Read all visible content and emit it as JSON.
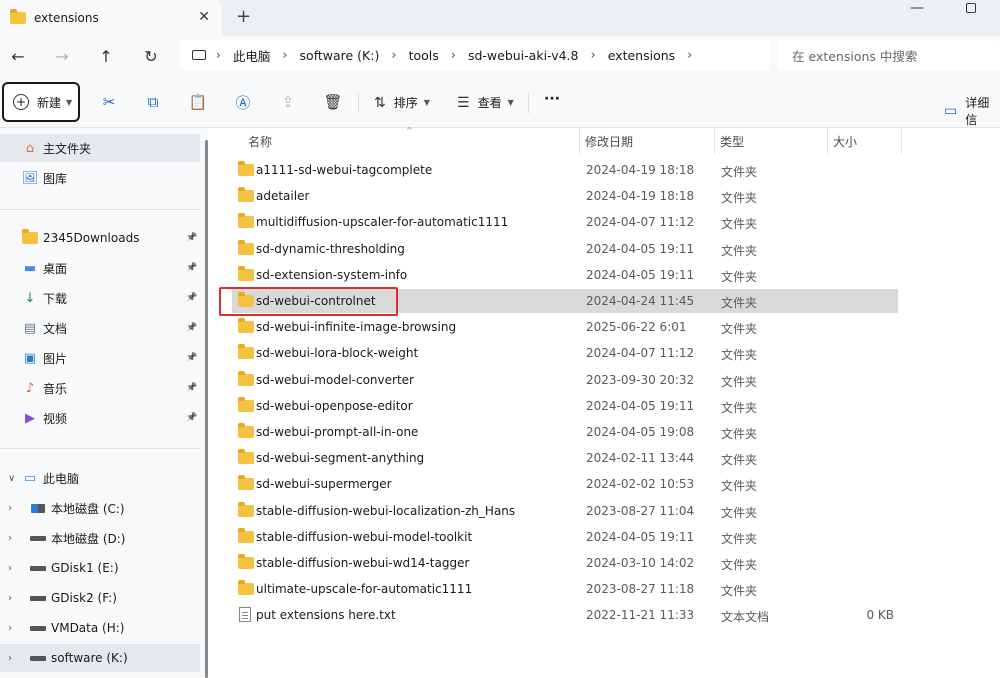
{
  "window": {
    "tab_title": "extensions",
    "close_tab": "✕",
    "new_tab": "+"
  },
  "nav": {
    "breadcrumb": [
      "此电脑",
      "software (K:)",
      "tools",
      "sd-webui-aki-v4.8",
      "extensions"
    ],
    "search_placeholder": "在 extensions 中搜索"
  },
  "toolbar": {
    "new_label": "新建",
    "sort_label": "排序",
    "view_label": "查看",
    "more_label": "···",
    "details_label": "详细信"
  },
  "sidebar": {
    "top": [
      {
        "label": "主文件夹",
        "icon": "home-icon",
        "selected": true
      },
      {
        "label": "图库",
        "icon": "gallery-icon",
        "selected": false
      }
    ],
    "pinned": [
      {
        "label": "2345Downloads",
        "icon": "folder-icon"
      },
      {
        "label": "桌面",
        "icon": "desktop-icon"
      },
      {
        "label": "下载",
        "icon": "download-icon"
      },
      {
        "label": "文档",
        "icon": "document-icon"
      },
      {
        "label": "图片",
        "icon": "pictures-icon"
      },
      {
        "label": "音乐",
        "icon": "music-icon"
      },
      {
        "label": "视频",
        "icon": "video-icon"
      }
    ],
    "pc": {
      "label": "此电脑",
      "icon": "pc-icon"
    },
    "drives": [
      {
        "label": "本地磁盘 (C:)",
        "icon": "windows-drive-icon",
        "selected": false
      },
      {
        "label": "本地磁盘 (D:)",
        "icon": "drive-icon",
        "selected": false
      },
      {
        "label": "GDisk1 (E:)",
        "icon": "drive-icon",
        "selected": false
      },
      {
        "label": "GDisk2 (F:)",
        "icon": "drive-icon",
        "selected": false
      },
      {
        "label": "VMData (H:)",
        "icon": "drive-icon",
        "selected": false
      },
      {
        "label": "software (K:)",
        "icon": "drive-icon",
        "selected": true
      }
    ]
  },
  "columns": {
    "name": "名称",
    "date": "修改日期",
    "type": "类型",
    "size": "大小"
  },
  "files": [
    {
      "name": "a1111-sd-webui-tagcomplete",
      "date": "2024-04-19 18:18",
      "type": "文件夹",
      "size": "",
      "kind": "folder"
    },
    {
      "name": "adetailer",
      "date": "2024-04-19 18:18",
      "type": "文件夹",
      "size": "",
      "kind": "folder"
    },
    {
      "name": "multidiffusion-upscaler-for-automatic1111",
      "date": "2024-04-07 11:12",
      "type": "文件夹",
      "size": "",
      "kind": "folder"
    },
    {
      "name": "sd-dynamic-thresholding",
      "date": "2024-04-05 19:11",
      "type": "文件夹",
      "size": "",
      "kind": "folder"
    },
    {
      "name": "sd-extension-system-info",
      "date": "2024-04-05 19:11",
      "type": "文件夹",
      "size": "",
      "kind": "folder"
    },
    {
      "name": "sd-webui-controlnet",
      "date": "2024-04-24 11:45",
      "type": "文件夹",
      "size": "",
      "kind": "folder"
    },
    {
      "name": "sd-webui-infinite-image-browsing",
      "date": "2025-06-22 6:01",
      "type": "文件夹",
      "size": "",
      "kind": "folder"
    },
    {
      "name": "sd-webui-lora-block-weight",
      "date": "2024-04-07 11:12",
      "type": "文件夹",
      "size": "",
      "kind": "folder"
    },
    {
      "name": "sd-webui-model-converter",
      "date": "2023-09-30 20:32",
      "type": "文件夹",
      "size": "",
      "kind": "folder"
    },
    {
      "name": "sd-webui-openpose-editor",
      "date": "2024-04-05 19:11",
      "type": "文件夹",
      "size": "",
      "kind": "folder"
    },
    {
      "name": "sd-webui-prompt-all-in-one",
      "date": "2024-04-05 19:08",
      "type": "文件夹",
      "size": "",
      "kind": "folder"
    },
    {
      "name": "sd-webui-segment-anything",
      "date": "2024-02-11 13:44",
      "type": "文件夹",
      "size": "",
      "kind": "folder"
    },
    {
      "name": "sd-webui-supermerger",
      "date": "2024-02-02 10:53",
      "type": "文件夹",
      "size": "",
      "kind": "folder"
    },
    {
      "name": "stable-diffusion-webui-localization-zh_Hans",
      "date": "2023-08-27 11:04",
      "type": "文件夹",
      "size": "",
      "kind": "folder"
    },
    {
      "name": "stable-diffusion-webui-model-toolkit",
      "date": "2024-04-05 19:11",
      "type": "文件夹",
      "size": "",
      "kind": "folder"
    },
    {
      "name": "stable-diffusion-webui-wd14-tagger",
      "date": "2024-03-10 14:02",
      "type": "文件夹",
      "size": "",
      "kind": "folder"
    },
    {
      "name": "ultimate-upscale-for-automatic1111",
      "date": "2023-08-27 11:18",
      "type": "文件夹",
      "size": "",
      "kind": "folder"
    },
    {
      "name": "put extensions here.txt",
      "date": "2022-11-21 11:33",
      "type": "文本文档",
      "size": "0 KB",
      "kind": "text"
    }
  ],
  "selected_file": "sd-webui-controlnet",
  "colors": {
    "accent": "#2563c9",
    "folder": "#f4c23e",
    "highlight_border": "#d9302c",
    "selected_row": "#d9d9d9"
  }
}
